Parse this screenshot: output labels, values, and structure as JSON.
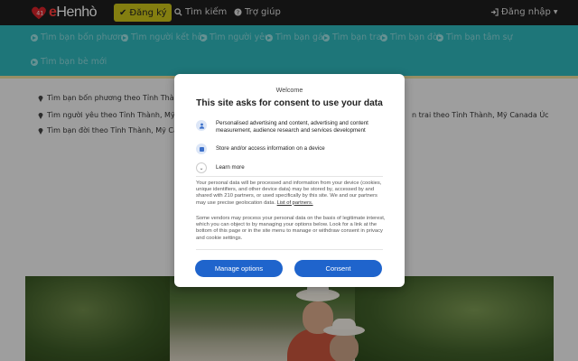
{
  "navbar": {
    "logo_prefix": "e",
    "logo_text": "Henhò",
    "register_label": "Đăng ký",
    "search_label": "Tìm kiếm",
    "help_label": "Trợ giúp",
    "login_label": "Đăng nhập"
  },
  "categories": [
    "Tìm bạn bốn phương",
    "Tìm người kết hôn",
    "Tìm người yêu",
    "Tìm bạn gái",
    "Tìm bạn trai",
    "Tìm bạn đời",
    "Tìm bạn tâm sự",
    "Tìm bạn bè mới"
  ],
  "background_links": [
    "Tìm bạn bốn phương theo Tỉnh Thành, M",
    "Tìm người yêu theo Tỉnh Thành, Mỹ Canada",
    "Tìm bạn đời theo Tỉnh Thành, Mỹ Canad",
    "n trai theo Tỉnh Thành, Mỹ Canada Úc"
  ],
  "consent": {
    "welcome": "Welcome",
    "title": "This site asks for consent to use your data",
    "purpose_1": "Personalised advertising and content, advertising and content measurement, audience research and services development",
    "purpose_2": "Store and/or access information on a device",
    "learn_more": "Learn more",
    "para_1": "Your personal data will be processed and information from your device (cookies, unique identifiers, and other device data) may be stored by, accessed by and shared with 210 partners, or used specifically by this site. We and our partners may use precise geolocation data.",
    "partners_link": "List of partners.",
    "para_2": "Some vendors may process your personal data on the basis of legitimate interest, which you can object to by managing your options below. Look for a link at the bottom of this page or in the site menu to manage or withdraw consent in privacy and cookie settings.",
    "manage_label": "Manage options",
    "consent_label": "Consent"
  },
  "colors": {
    "navbar": "#1e1e1e",
    "accent_teal": "#2fb5bb",
    "register_yellow": "#c9c21a",
    "button_blue": "#1f64cc",
    "logo_red": "#ff3b3b"
  }
}
